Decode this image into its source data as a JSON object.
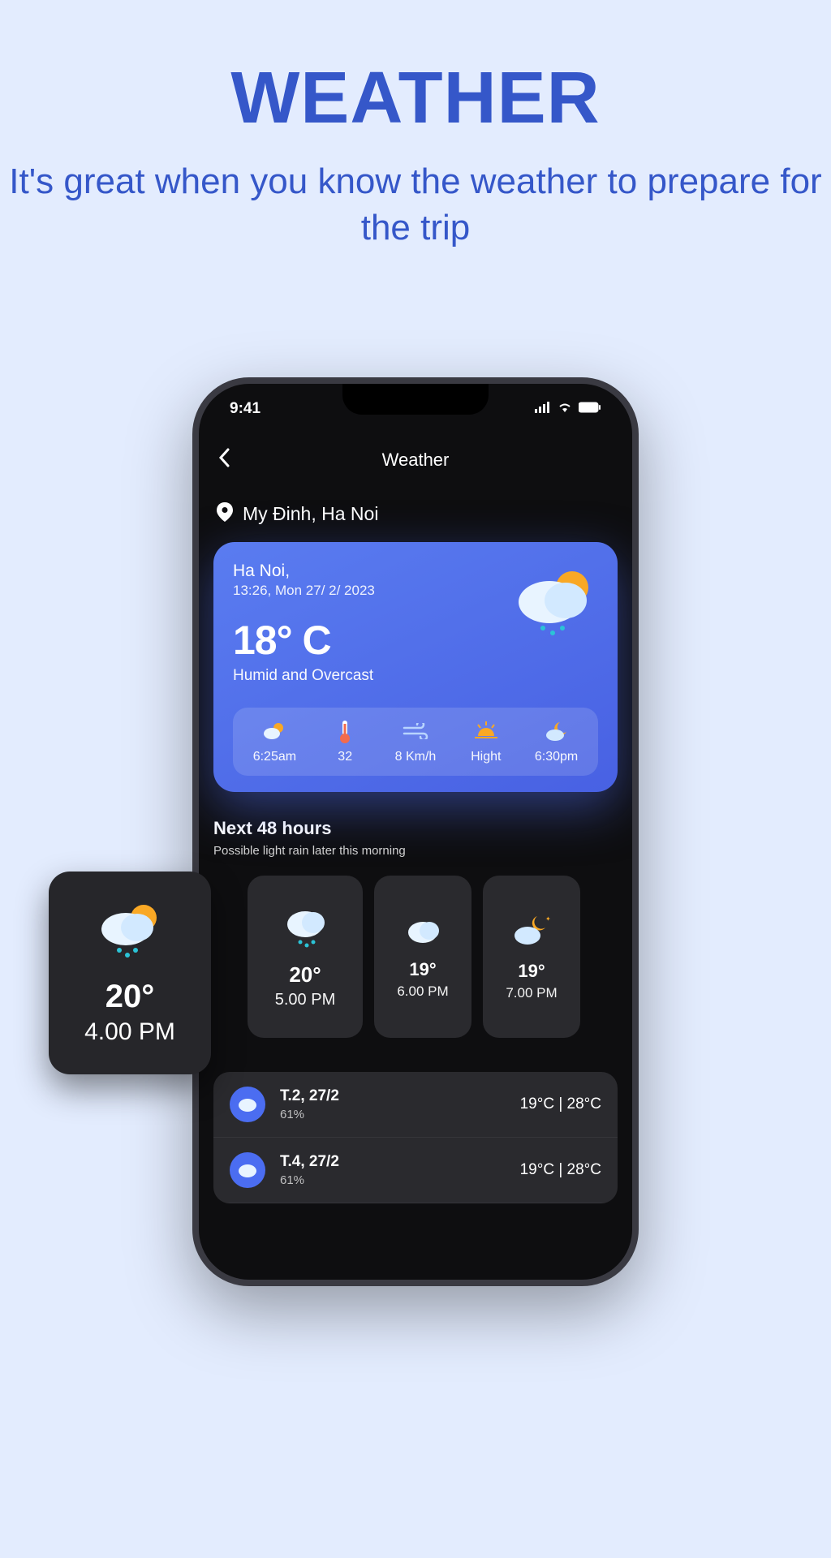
{
  "hero": {
    "title": "WEATHER",
    "subtitle": "It's great when you know the weather to prepare for the trip"
  },
  "status": {
    "time": "9:41"
  },
  "app": {
    "title": "Weather",
    "location": "My Đinh, Ha Noi"
  },
  "current": {
    "city": "Ha Noi,",
    "datetime": "13:26, Mon 27/ 2/ 2023",
    "temp": "18° C",
    "condition": "Humid and Overcast",
    "metrics": [
      {
        "icon": "partly-cloudy-icon",
        "value": "6:25am"
      },
      {
        "icon": "thermometer-icon",
        "value": "32"
      },
      {
        "icon": "wind-icon",
        "value": "8 Km/h"
      },
      {
        "icon": "sunset-icon",
        "value": "Hight"
      },
      {
        "icon": "night-cloudy-icon",
        "value": "6:30pm"
      }
    ]
  },
  "forecast48": {
    "title": "Next 48 hours",
    "subtitle": "Possible light rain later this morning",
    "featured": {
      "temp": "20°",
      "time": "4.00 PM"
    },
    "hours": [
      {
        "temp": "20°",
        "time": "5.00 PM",
        "icon": "rain"
      },
      {
        "temp": "19°",
        "time": "6.00 PM",
        "icon": "cloud"
      },
      {
        "temp": "19°",
        "time": "7.00 PM",
        "icon": "night"
      }
    ]
  },
  "daily": [
    {
      "label": "T.2, 27/2",
      "humidity": "61%",
      "temps": "19°C | 28°C"
    },
    {
      "label": "T.4, 27/2",
      "humidity": "61%",
      "temps": "19°C | 28°C"
    }
  ]
}
